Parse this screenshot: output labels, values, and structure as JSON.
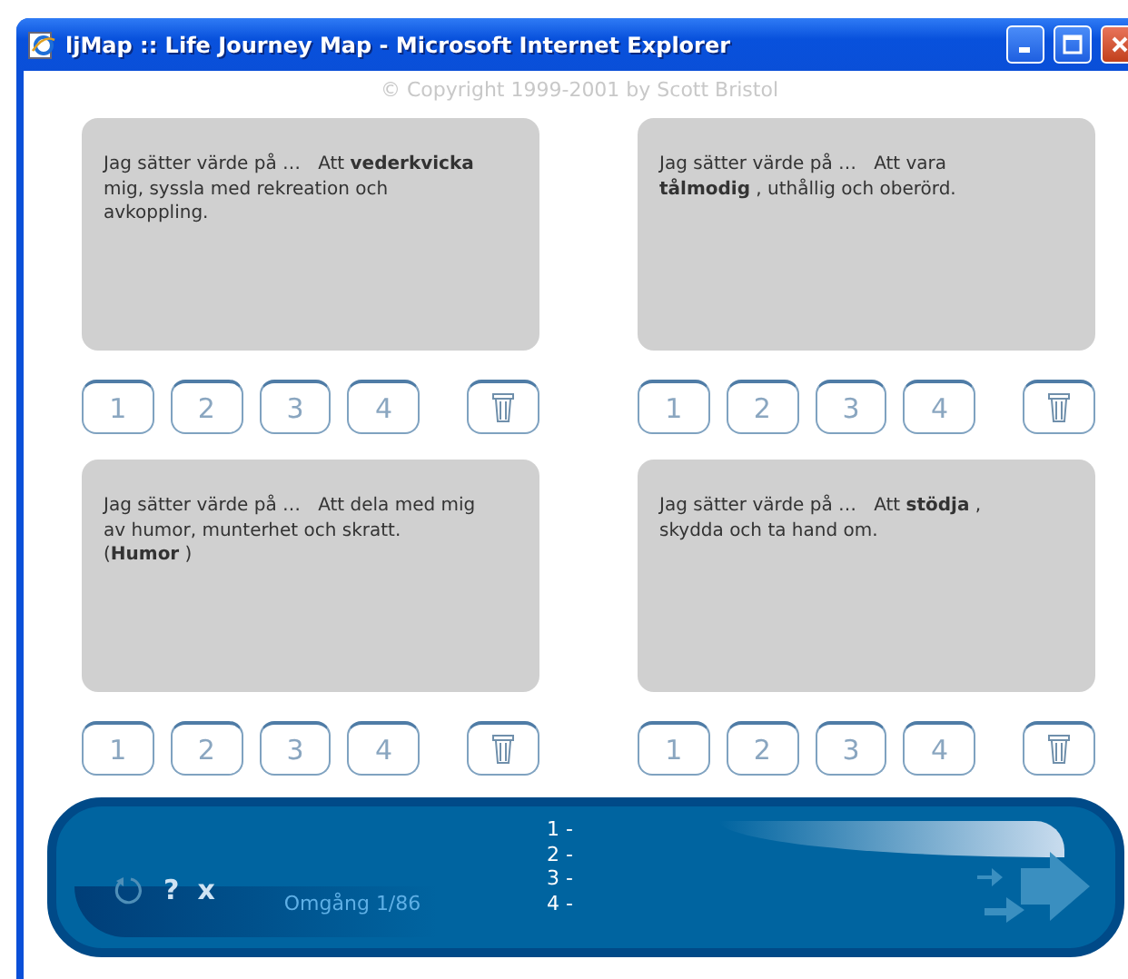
{
  "window": {
    "title": "ljMap :: Life Journey Map - Microsoft Internet Explorer"
  },
  "copyright": "© Copyright 1999-2001 by Scott Bristol",
  "cards": [
    {
      "text": "Jag sätter värde på …   Att **vederkvicka** mig, syssla med rekreation och avkoppling.",
      "ranks": [
        "1",
        "2",
        "3",
        "4"
      ]
    },
    {
      "text": "Jag sätter värde på …   Att vara **tålmodig** , uthållig och oberörd.",
      "ranks": [
        "1",
        "2",
        "3",
        "4"
      ]
    },
    {
      "text": "Jag sätter värde på …   Att dela med mig av humor, munterhet och skratt.   (**Humor** )",
      "ranks": [
        "1",
        "2",
        "3",
        "4"
      ]
    },
    {
      "text": "Jag sätter värde på …   Att **stödja** , skydda och ta hand om.",
      "ranks": [
        "1",
        "2",
        "3",
        "4"
      ]
    }
  ],
  "footer": {
    "help": "?",
    "close": "x",
    "round": "Omgång 1/86",
    "ranking": [
      "1 -",
      "2 -",
      "3 -",
      "4 -"
    ]
  }
}
